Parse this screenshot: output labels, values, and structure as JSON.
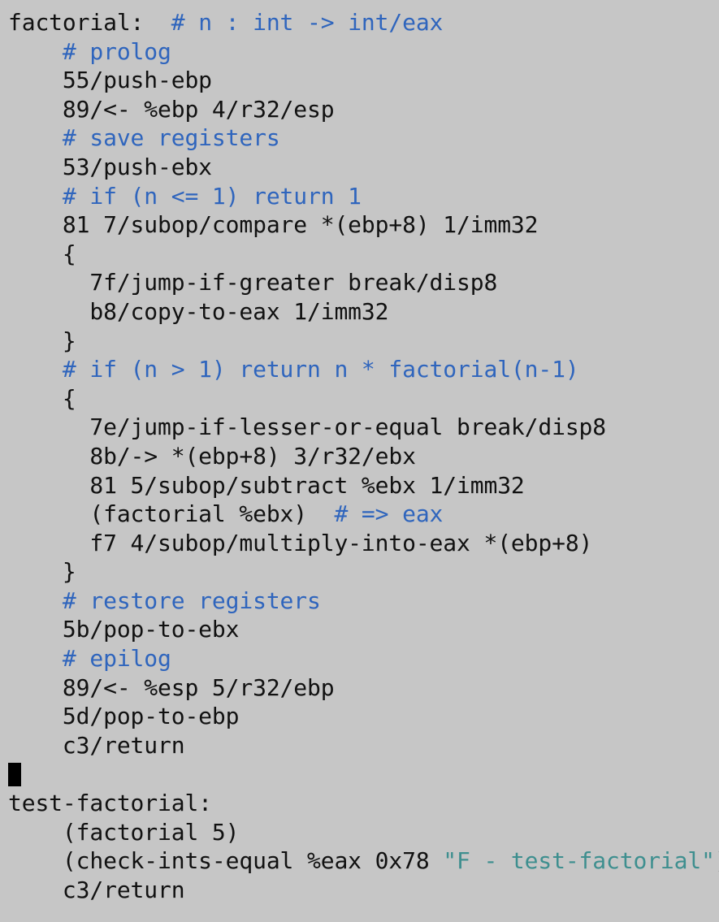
{
  "editor": {
    "background_color": "#c6c6c6",
    "code_color": "#111111",
    "comment_color": "#2f65bd",
    "string_color": "#3e8f8f",
    "cursor_color": "#000000",
    "cursor_line_index": 26,
    "lines": [
      {
        "tokens": [
          {
            "t": "code",
            "s": "factorial:  "
          },
          {
            "t": "comment",
            "s": "# n : int -> int/eax"
          }
        ]
      },
      {
        "tokens": [
          {
            "t": "comment",
            "s": "    # prolog"
          }
        ]
      },
      {
        "tokens": [
          {
            "t": "code",
            "s": "    55/push-ebp"
          }
        ]
      },
      {
        "tokens": [
          {
            "t": "code",
            "s": "    89/<- %ebp 4/r32/esp"
          }
        ]
      },
      {
        "tokens": [
          {
            "t": "comment",
            "s": "    # save registers"
          }
        ]
      },
      {
        "tokens": [
          {
            "t": "code",
            "s": "    53/push-ebx"
          }
        ]
      },
      {
        "tokens": [
          {
            "t": "comment",
            "s": "    # if (n <= 1) return 1"
          }
        ]
      },
      {
        "tokens": [
          {
            "t": "code",
            "s": "    81 7/subop/compare *(ebp+8) 1/imm32"
          }
        ]
      },
      {
        "tokens": [
          {
            "t": "code",
            "s": "    {"
          }
        ]
      },
      {
        "tokens": [
          {
            "t": "code",
            "s": "      7f/jump-if-greater break/disp8"
          }
        ]
      },
      {
        "tokens": [
          {
            "t": "code",
            "s": "      b8/copy-to-eax 1/imm32"
          }
        ]
      },
      {
        "tokens": [
          {
            "t": "code",
            "s": "    }"
          }
        ]
      },
      {
        "tokens": [
          {
            "t": "comment",
            "s": "    # if (n > 1) return n * factorial(n-1)"
          }
        ]
      },
      {
        "tokens": [
          {
            "t": "code",
            "s": "    {"
          }
        ]
      },
      {
        "tokens": [
          {
            "t": "code",
            "s": "      7e/jump-if-lesser-or-equal break/disp8"
          }
        ]
      },
      {
        "tokens": [
          {
            "t": "code",
            "s": "      8b/-> *(ebp+8) 3/r32/ebx"
          }
        ]
      },
      {
        "tokens": [
          {
            "t": "code",
            "s": "      81 5/subop/subtract %ebx 1/imm32"
          }
        ]
      },
      {
        "tokens": [
          {
            "t": "code",
            "s": "      (factorial %ebx)  "
          },
          {
            "t": "comment",
            "s": "# => eax"
          }
        ]
      },
      {
        "tokens": [
          {
            "t": "code",
            "s": "      f7 4/subop/multiply-into-eax *(ebp+8)"
          }
        ]
      },
      {
        "tokens": [
          {
            "t": "code",
            "s": "    }"
          }
        ]
      },
      {
        "tokens": [
          {
            "t": "comment",
            "s": "    # restore registers"
          }
        ]
      },
      {
        "tokens": [
          {
            "t": "code",
            "s": "    5b/pop-to-ebx"
          }
        ]
      },
      {
        "tokens": [
          {
            "t": "comment",
            "s": "    # epilog"
          }
        ]
      },
      {
        "tokens": [
          {
            "t": "code",
            "s": "    89/<- %esp 5/r32/ebp"
          }
        ]
      },
      {
        "tokens": [
          {
            "t": "code",
            "s": "    5d/pop-to-ebp"
          }
        ]
      },
      {
        "tokens": [
          {
            "t": "code",
            "s": "    c3/return"
          }
        ]
      },
      {
        "tokens": [
          {
            "t": "code",
            "s": ""
          }
        ]
      },
      {
        "tokens": [
          {
            "t": "code",
            "s": "test-factorial:"
          }
        ]
      },
      {
        "tokens": [
          {
            "t": "code",
            "s": "    (factorial 5)"
          }
        ]
      },
      {
        "tokens": [
          {
            "t": "code",
            "s": "    (check-ints-equal %eax 0x78 "
          },
          {
            "t": "string",
            "s": "\"F - test-factorial\""
          },
          {
            "t": "code",
            "s": ")"
          }
        ]
      },
      {
        "tokens": [
          {
            "t": "code",
            "s": "    c3/return"
          }
        ]
      }
    ]
  }
}
